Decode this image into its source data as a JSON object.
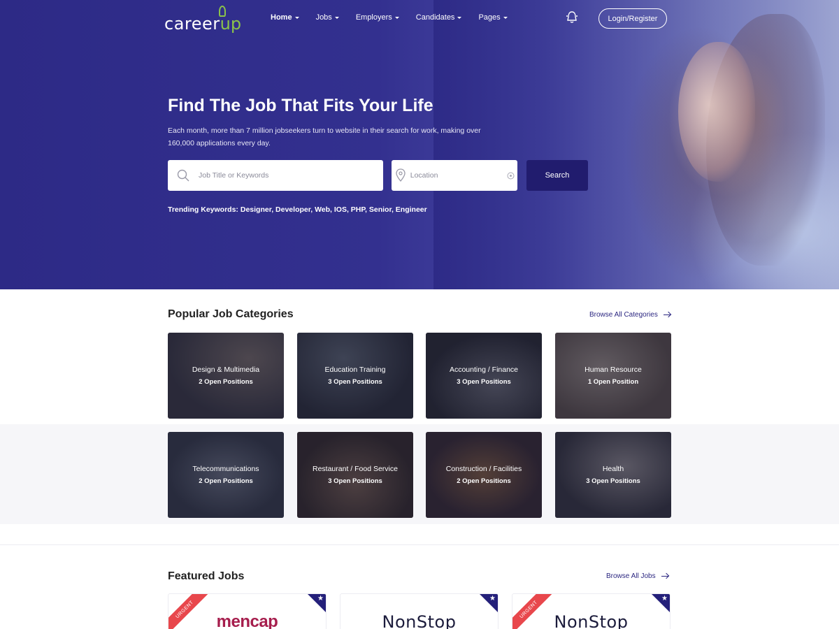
{
  "brand": {
    "name_part1": "career",
    "name_part2": "up"
  },
  "nav": {
    "items": [
      {
        "label": "Home",
        "active": true
      },
      {
        "label": "Jobs",
        "active": false
      },
      {
        "label": "Employers",
        "active": false
      },
      {
        "label": "Candidates",
        "active": false
      },
      {
        "label": "Pages",
        "active": false
      }
    ],
    "login_label": "Login/Register",
    "notification_icon": "bell-icon"
  },
  "hero": {
    "title": "Find The Job That Fits Your Life",
    "subtitle": "Each month, more than 7 million jobseekers turn to website in their search for work, making over 160,000 applications every day.",
    "keyword_placeholder": "Job Title or Keywords",
    "location_placeholder": "Location",
    "search_button": "Search",
    "trending_label": "Trending Keywords:",
    "trending_keywords": "Designer, Developer, Web, IOS, PHP, Senior, Engineer"
  },
  "categories": {
    "title": "Popular Job Categories",
    "browse_label": "Browse All Categories",
    "items": [
      {
        "name": "Design & Multimedia",
        "count": "2",
        "count_suffix": "Open Positions"
      },
      {
        "name": "Education Training",
        "count": "3",
        "count_suffix": "Open Positions"
      },
      {
        "name": "Accounting / Finance",
        "count": "3",
        "count_suffix": "Open Positions"
      },
      {
        "name": "Human Resource",
        "count": "1",
        "count_suffix": "Open Position"
      },
      {
        "name": "Telecommunications",
        "count": "2",
        "count_suffix": "Open Positions"
      },
      {
        "name": "Restaurant / Food Service",
        "count": "3",
        "count_suffix": "Open Positions"
      },
      {
        "name": "Construction / Facilities",
        "count": "2",
        "count_suffix": "Open Positions"
      },
      {
        "name": "Health",
        "count": "3",
        "count_suffix": "Open Positions"
      }
    ]
  },
  "featured": {
    "title": "Featured Jobs",
    "browse_label": "Browse All Jobs",
    "urgent_label": "URGENT",
    "jobs": [
      {
        "company_logo_text": "mencap",
        "urgent": true
      },
      {
        "company_logo_text": "NonStop",
        "urgent": false
      },
      {
        "company_logo_text": "NonStop",
        "urgent": true
      }
    ]
  },
  "colors": {
    "primary": "#2b2680",
    "accent_green": "#8bc34a",
    "urgent_red": "#e8474c"
  }
}
